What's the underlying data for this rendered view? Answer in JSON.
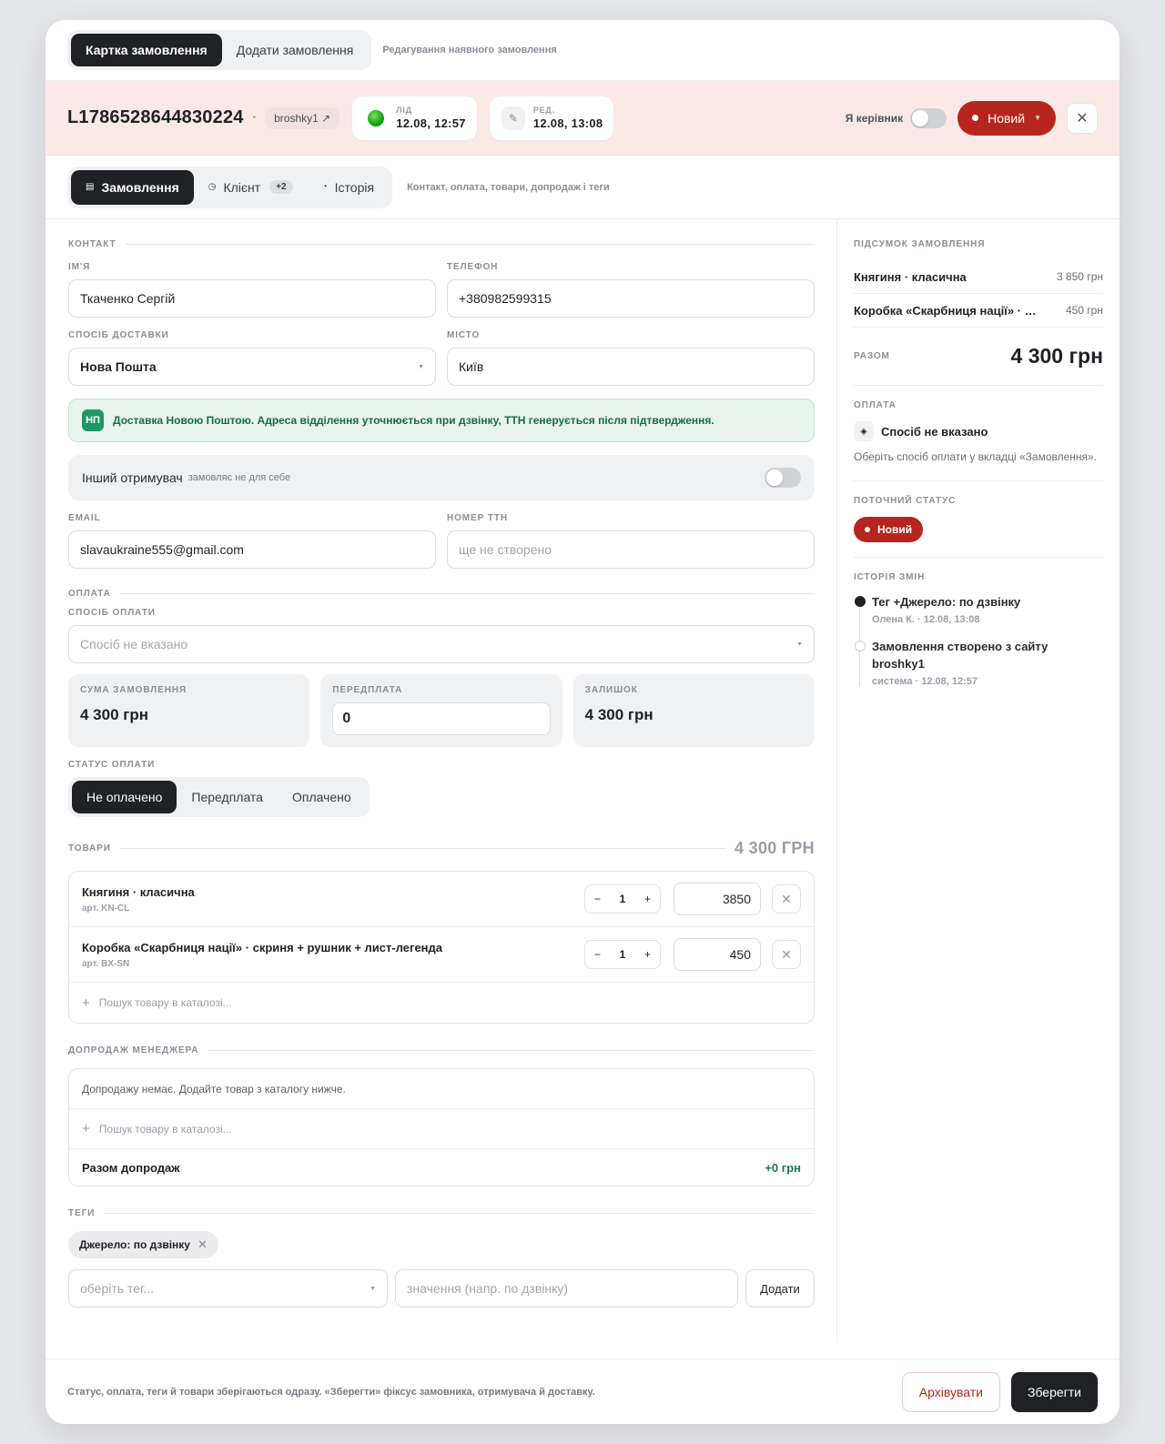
{
  "top_tabs": {
    "card": "Картка замовлення",
    "add": "Додати замовлення",
    "hint": "Редагування наявного замовлення"
  },
  "header": {
    "order_id": "L1786528644830224",
    "source": "broshky1",
    "lead_label": "ЛІД",
    "lead_time": "12.08, 12:57",
    "edit_label": "РЕД.",
    "edit_time": "12.08, 13:08",
    "manager_label": "Я керівник",
    "status": "Новий",
    "accent": "#b7261e"
  },
  "tabs": {
    "order": "Замовлення",
    "client": "Клієнт",
    "client_badge": "+2",
    "history": "Історія",
    "hint": "Контакт, оплата, товари, допродаж і теги"
  },
  "contact": {
    "section": "КОНТАКТ",
    "name_label": "ІМ'Я",
    "name": "Ткаченко Сергій",
    "phone_label": "ТЕЛЕФОН",
    "phone": "+380982599315",
    "delivery_label": "СПОСІБ ДОСТАВКИ",
    "delivery": "Нова Пошта",
    "city_label": "МІСТО",
    "city": "Київ",
    "np_logo": "НП",
    "np_note": "Доставка Новою Поштою. Адреса відділення уточнюється при дзвінку, ТТН генерується після підтвердження.",
    "other_recv": "Інший отримувач",
    "other_recv_sub": "замовляє не для себе",
    "email_label": "EMAIL",
    "email": "slavaukraine555@gmail.com",
    "ttn_label": "НОМЕР ТТН",
    "ttn_placeholder": "ще не створено"
  },
  "payment": {
    "section": "ОПЛАТА",
    "method_label": "СПОСІБ ОПЛАТИ",
    "method_placeholder": "Спосіб не вказано",
    "sum_label": "СУМА ЗАМОВЛЕННЯ",
    "sum": "4 300 грн",
    "prepay_label": "ПЕРЕДПЛАТА",
    "prepay": "0",
    "rest_label": "ЗАЛИШОК",
    "rest": "4 300 грн",
    "status_label": "СТАТУС ОПЛАТИ",
    "statuses": [
      "Не оплачено",
      "Передплата",
      "Оплачено"
    ]
  },
  "goods": {
    "section": "ТОВАРИ",
    "total": "4 300 ГРН",
    "items": [
      {
        "name": "Княгиня · класична",
        "sku": "арт. KN-CL",
        "qty": "1",
        "price": "3850"
      },
      {
        "name": "Коробка «Скарбниця нації» · скриня + рушник + лист-легенда",
        "sku": "арт. BX-SN",
        "qty": "1",
        "price": "450"
      }
    ],
    "search": "Пошук товару в каталозі..."
  },
  "upsell": {
    "section": "ДОПРОДАЖ МЕНЕДЖЕРА",
    "empty": "Допродажу немає. Додайте товар з каталогу нижче.",
    "search": "Пошук товару в каталозі...",
    "total_label": "Разом допродаж",
    "total": "+0 грн"
  },
  "tags": {
    "section": "ТЕГИ",
    "chip": "Джерело: по дзвінку",
    "select_placeholder": "оберіть тег...",
    "value_placeholder": "значення (напр. по дзвінку)",
    "add": "Додати"
  },
  "summary": {
    "title": "ПІДСУМОК ЗАМОВЛЕННЯ",
    "lines": [
      {
        "name": "Княгиня · класична",
        "price": "3 850 грн"
      },
      {
        "name": "Коробка «Скарбниця нації» · скриня + рушник + лист-легенда",
        "price": "450 грн"
      }
    ],
    "total_label": "РАЗОМ",
    "total": "4 300 грн",
    "pay_title": "ОПЛАТА",
    "pay_method": "Спосіб не вказано",
    "pay_note": "Оберіть спосіб оплати у вкладці «Замовлення».",
    "status_title": "ПОТОЧНИЙ СТАТУС",
    "status": "Новий",
    "history_title": "ІСТОРІЯ ЗМІН",
    "history": [
      {
        "text": "Тег +Джерело: по дзвінку",
        "meta": "Олена К. · 12.08, 13:08"
      },
      {
        "text": "Замовлення створено з сайту broshky1",
        "meta": "система · 12.08, 12:57"
      }
    ]
  },
  "footer": {
    "note": "Статус, оплата, теги й товари зберігаються одразу. «Зберегти» фіксує замовника, отримувача й доставку.",
    "archive": "Архівувати",
    "save": "Зберегти"
  }
}
